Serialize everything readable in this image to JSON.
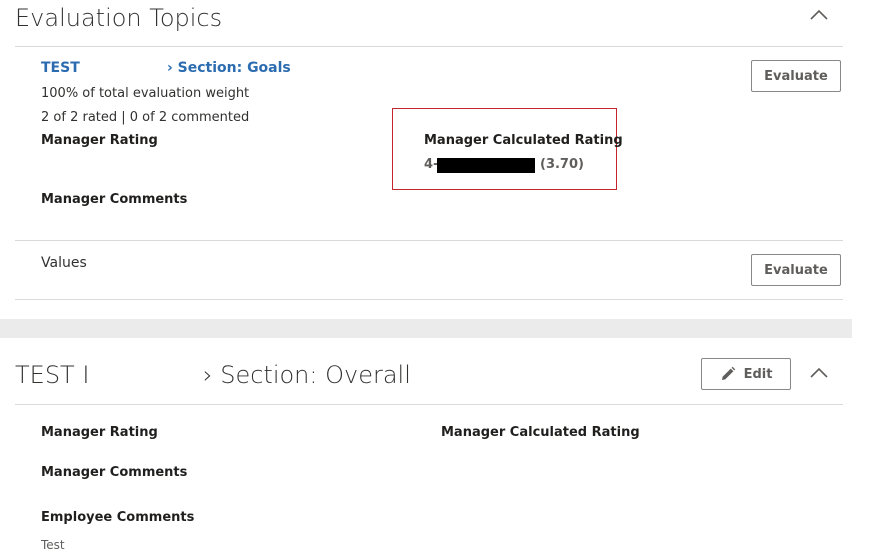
{
  "evaluation_topics": {
    "title": "Evaluation Topics",
    "goals": {
      "link_left": "TEST",
      "link_right": "› Section: Goals",
      "weight_text": "100% of total evaluation weight",
      "progress_text": "2 of 2 rated | 0 of 2 commented",
      "manager_rating_label": "Manager Rating",
      "manager_comments_label": "Manager Comments",
      "calc_label": "Manager Calculated Rating",
      "calc_prefix": "4-",
      "calc_score": "(3.70)",
      "evaluate_label": "Evaluate"
    },
    "values": {
      "label": "Values",
      "evaluate_label": "Evaluate"
    }
  },
  "overall": {
    "title_left": "TEST I",
    "title_right": "› Section: Overall",
    "edit_label": "Edit",
    "manager_rating_label": "Manager Rating",
    "calc_label": "Manager Calculated Rating",
    "manager_comments_label": "Manager Comments",
    "employee_comments_label": "Employee Comments",
    "employee_comment_value": "Test"
  },
  "colors": {
    "link": "#2b6cb0",
    "highlight_border": "#c4262e",
    "divider": "#d9d9d9",
    "band": "#ebebeb"
  }
}
